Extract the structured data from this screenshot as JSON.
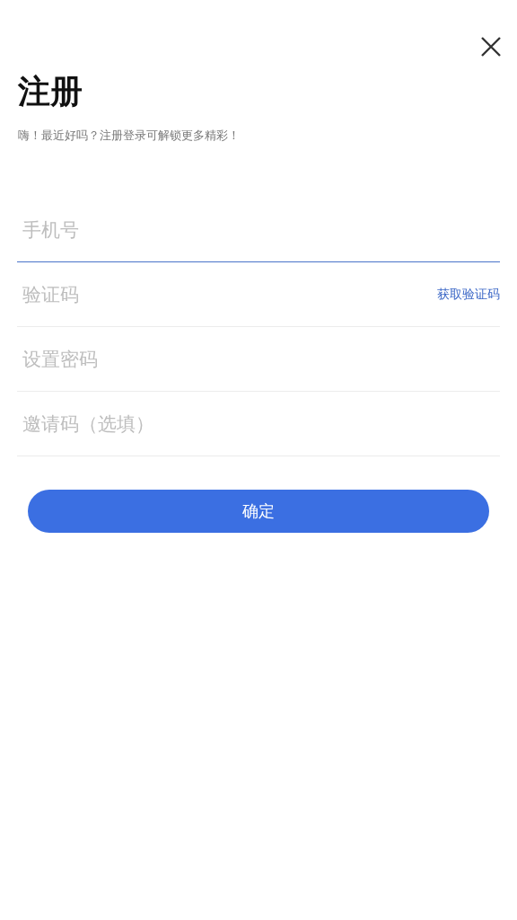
{
  "title": "注册",
  "subtitle": "嗨！最近好吗？注册登录可解锁更多精彩！",
  "fields": [
    {
      "placeholder": "手机号",
      "focused": true
    },
    {
      "placeholder": "验证码",
      "focused": false,
      "action": "获取验证码"
    },
    {
      "placeholder": "设置密码",
      "focused": false
    },
    {
      "placeholder": "邀请码（选填）",
      "focused": false
    }
  ],
  "submit": "确定"
}
